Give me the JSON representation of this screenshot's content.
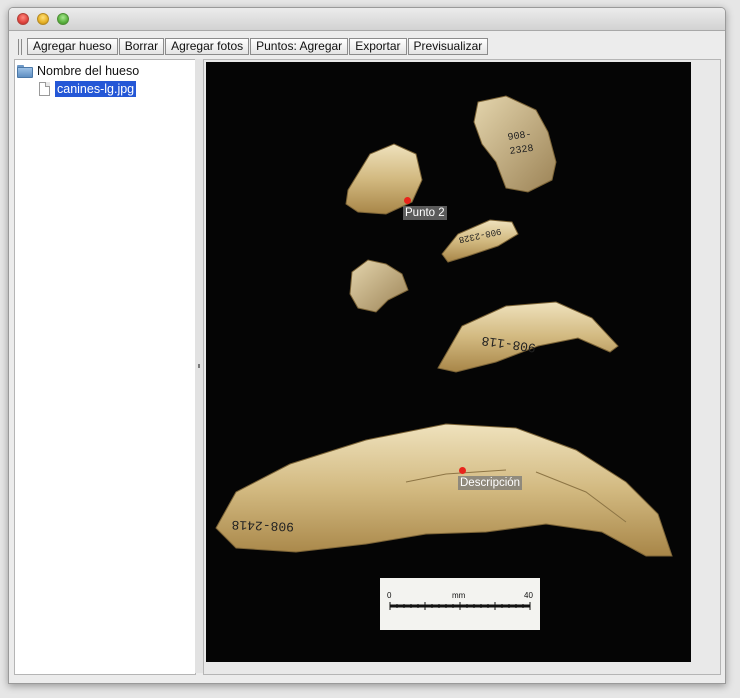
{
  "window": {
    "controls": {
      "close_icon": "close-icon",
      "minimize_icon": "minimize-icon",
      "zoom_icon": "zoom-icon"
    }
  },
  "toolbar": {
    "buttons": [
      {
        "label": "Agregar hueso"
      },
      {
        "label": "Borrar"
      },
      {
        "label": "Agregar fotos"
      },
      {
        "label": "Puntos: Agregar"
      },
      {
        "label": "Exportar"
      },
      {
        "label": "Previsualizar"
      }
    ]
  },
  "tree": {
    "root_label": "Nombre del hueso",
    "root_icon": "folder-icon",
    "file_label": "canines-lg.jpg",
    "file_icon": "file-icon",
    "selection_color": "#2457d6"
  },
  "viewer": {
    "points": [
      {
        "label": "Punto 2"
      },
      {
        "label": "Descripción"
      }
    ],
    "point_color": "#e8241b",
    "specimen_labels": [
      "908-",
      "2328",
      "908-2328",
      "908-118",
      "908-2418"
    ],
    "scale_bar": {
      "start": "0",
      "unit": "mm",
      "end": "40"
    }
  }
}
